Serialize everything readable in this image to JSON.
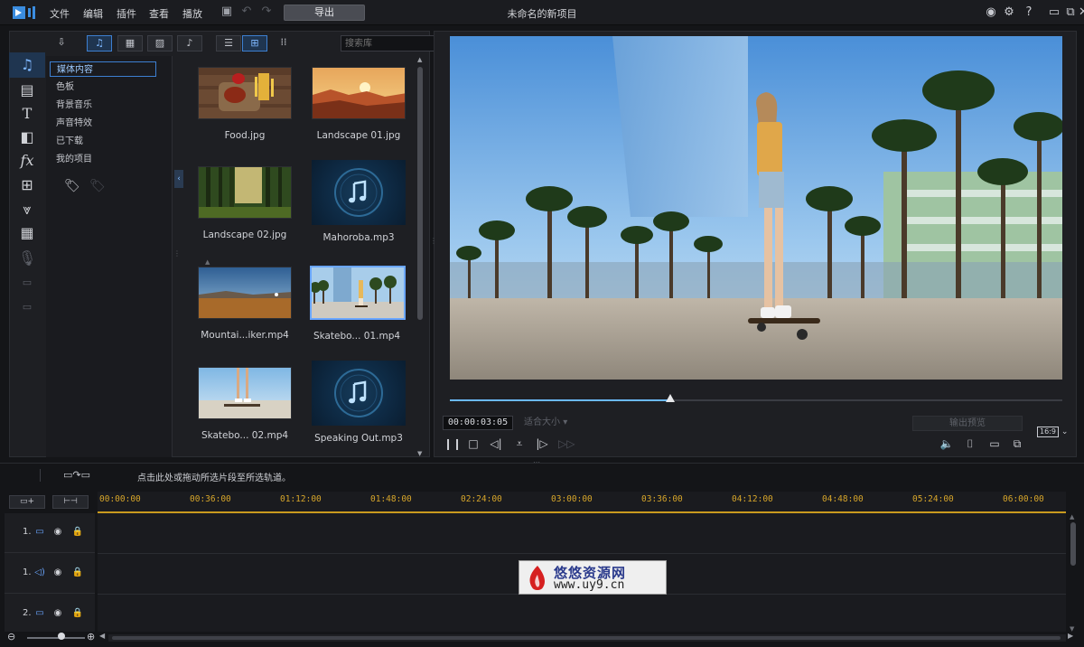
{
  "titlebar": {
    "menu": [
      "文件",
      "编辑",
      "插件",
      "查看",
      "播放"
    ],
    "export_label": "导出",
    "project_title": "未命名的新项目",
    "window_buttons": {
      "minimize": "▭",
      "restore": "⧉",
      "close": "✕"
    }
  },
  "media": {
    "search_placeholder": "搜索库",
    "categories": [
      "媒体内容",
      "色板",
      "背景音乐",
      "声音特效",
      "已下载",
      "我的项目"
    ],
    "active_category": "媒体内容",
    "items": [
      {
        "label": "Food.jpg",
        "kind": "image"
      },
      {
        "label": "Landscape 01.jpg",
        "kind": "image"
      },
      {
        "label": "Landscape 02.jpg",
        "kind": "image"
      },
      {
        "label": "Mahoroba.mp3",
        "kind": "audio"
      },
      {
        "label": "Mountai...iker.mp4",
        "kind": "video"
      },
      {
        "label": "Skatebo... 01.mp4",
        "kind": "video",
        "selected": true
      },
      {
        "label": "Skatebo... 02.mp4",
        "kind": "video"
      },
      {
        "label": "Speaking Out.mp3",
        "kind": "audio"
      }
    ]
  },
  "preview": {
    "timecode": "00:00:03:05",
    "fit_label": "适合大小",
    "export_frame_label": "输出预览",
    "aspect_label": "16:9",
    "progress": 0.36
  },
  "timeline": {
    "hint": "点击此处或拖动所选片段至所选轨道。",
    "ticks": [
      "00:00:00",
      "00:36:00",
      "01:12:00",
      "01:48:00",
      "02:24:00",
      "03:00:00",
      "03:36:00",
      "04:12:00",
      "04:48:00",
      "05:24:00",
      "06:00:00"
    ],
    "tracks": [
      {
        "num": "1.",
        "kind": "video"
      },
      {
        "num": "1.",
        "kind": "audio"
      },
      {
        "num": "2.",
        "kind": "video"
      }
    ]
  },
  "watermark": {
    "title": "悠悠资源网",
    "url": "www.uy9.cn"
  },
  "colors": {
    "accent": "#3d7fd1",
    "ruler": "#d6a52a",
    "progress": "#6ab8f7"
  }
}
